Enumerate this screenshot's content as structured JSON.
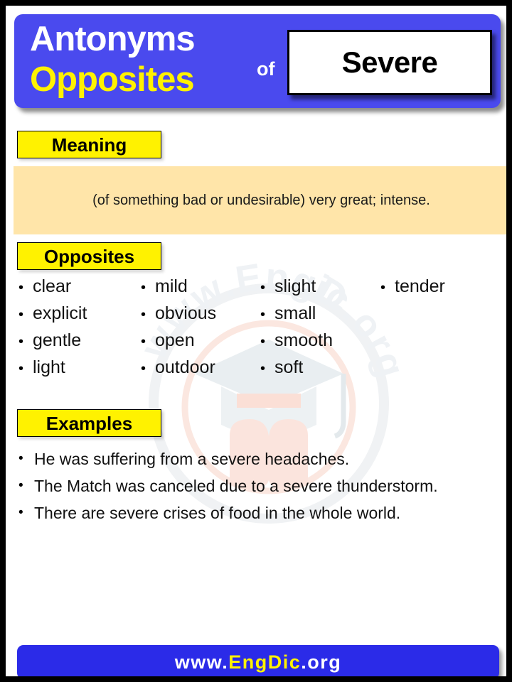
{
  "poster": {
    "border_color": "#000000",
    "background": "#ffffff"
  },
  "header": {
    "title_line1": "Antonyms",
    "title_line2": "Opposites",
    "connector": "of",
    "word": "Severe",
    "bg_color": "#4A4AEE",
    "line1_color": "#ffffff",
    "line2_color": "#FFF200"
  },
  "sections": {
    "meaning": {
      "label": "Meaning",
      "text": "(of something bad or undesirable) very great; intense.",
      "box_color": "#FFE5A9"
    },
    "opposites": {
      "label": "Opposites",
      "bullet": "•",
      "columns": [
        {
          "words": [
            "clear",
            "explicit",
            "gentle",
            "light"
          ]
        },
        {
          "words": [
            "mild",
            "obvious",
            "open",
            "outdoor"
          ]
        },
        {
          "words": [
            "slight",
            "small",
            "smooth",
            "soft"
          ]
        },
        {
          "words": [
            "tender"
          ]
        }
      ]
    },
    "examples": {
      "label": "Examples",
      "bullet": "•",
      "items": [
        "He was suffering from a severe headaches.",
        "The Match was canceled due to a severe thunderstorm.",
        "There are severe crises of food in the whole world."
      ]
    }
  },
  "label_style": {
    "bg_color": "#FFF200",
    "text_color": "#000000"
  },
  "watermark": {
    "text": "www.EngDic.org",
    "cap_color": "#E8EDF0",
    "book_color": "#FAE3DC",
    "ring_color": "#F2F4F6"
  },
  "footer": {
    "prefix": "www.",
    "brand": "EngDic",
    "suffix": ".org",
    "bg_color": "#2B2BE8",
    "brand_color": "#FFF200",
    "text_color": "#ffffff"
  }
}
